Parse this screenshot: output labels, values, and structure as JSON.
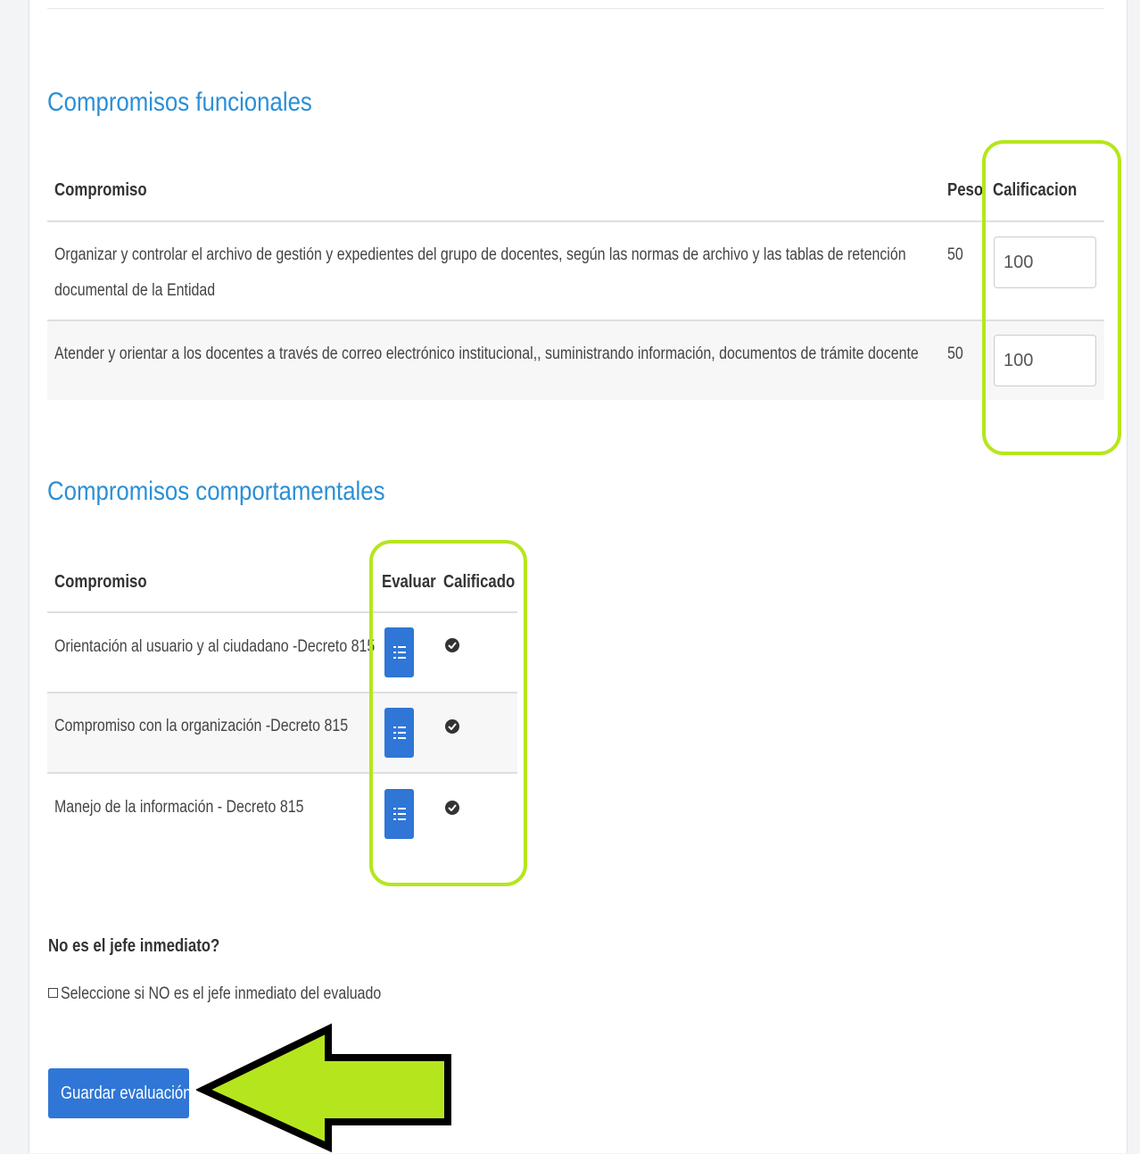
{
  "functional": {
    "title": "Compromisos funcionales",
    "headers": {
      "compromiso": "Compromiso",
      "peso": "Peso",
      "calificacion": "Calificacion"
    },
    "rows": [
      {
        "line1": "Organizar y controlar el archivo de gestión y expedientes del grupo de docentes, según las normas de archivo y las tablas de retención",
        "line2": "documental de la Entidad",
        "peso": "50",
        "calificacion": "100"
      },
      {
        "line1": "Atender y orientar a los docentes a través de correo electrónico institucional,, suministrando información, documentos de trámite docente",
        "peso": "50",
        "calificacion": "100"
      }
    ]
  },
  "behavioral": {
    "title": "Compromisos comportamentales",
    "headers": {
      "compromiso": "Compromiso",
      "evaluar": "Evaluar",
      "calificado": "Calificado"
    },
    "rows": [
      {
        "label": "Orientación al usuario y al ciudadano -Decreto 815",
        "evaluate_icon": "list-check-icon",
        "status_icon": "check-circle-icon"
      },
      {
        "label": "Compromiso con la organización -Decreto 815",
        "evaluate_icon": "list-check-icon",
        "status_icon": "check-circle-icon"
      },
      {
        "label": "Manejo de la información - Decreto 815",
        "evaluate_icon": "list-check-icon",
        "status_icon": "check-circle-icon"
      }
    ]
  },
  "not_boss": {
    "heading": "No es el jefe inmediato?",
    "checkbox_label": "Seleccione si NO es el jefe inmediato del evaluado"
  },
  "save_label": "Guardar evaluación",
  "colors": {
    "accent": "#2f76d6",
    "title": "#2a8fd6",
    "highlight": "#b5e61d"
  }
}
